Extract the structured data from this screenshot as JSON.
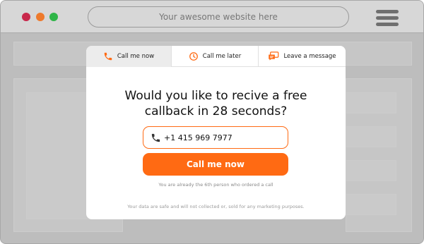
{
  "browser": {
    "url_placeholder": "Your awesome website here",
    "dot_colors": [
      "#c8284b",
      "#ee7a2c",
      "#2fb548"
    ]
  },
  "widget": {
    "accent_color": "#ff6a13",
    "tabs": [
      {
        "label": "Call me now",
        "icon": "phone-icon",
        "active": true
      },
      {
        "label": "Call me later",
        "icon": "clock-icon",
        "active": false
      },
      {
        "label": "Leave a message",
        "icon": "message-icon",
        "active": false
      }
    ],
    "headline_line1": "Would you like to recive a free",
    "headline_line2": "callback in 28 seconds?",
    "phone_value": "+1 415 969 7977",
    "button_label": "Call me now",
    "notice": "You are already the 6th person who ordered a call",
    "privacy": "Your data are safe and will not collected or, sold for any marketing purposes."
  }
}
